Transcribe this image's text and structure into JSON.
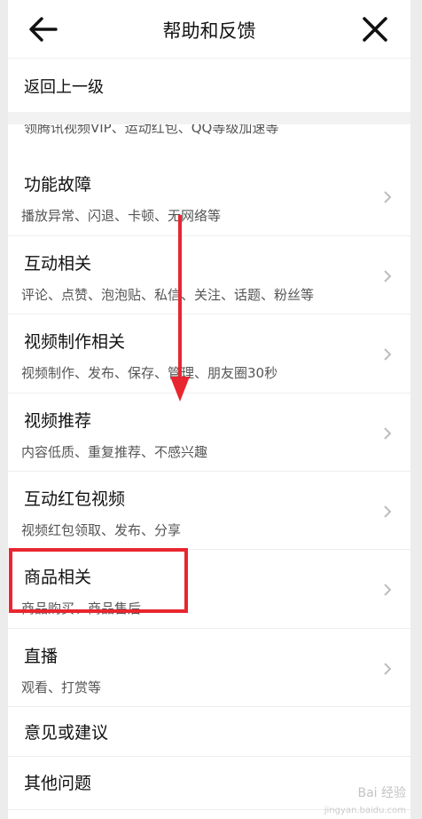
{
  "header": {
    "title": "帮助和反馈",
    "back_icon": "arrow-left-icon",
    "close_icon": "close-icon"
  },
  "back_row": {
    "label": "返回上一级"
  },
  "partial_row": {
    "subtitle": "领腾讯视频VIP、运动红包、QQ等级加速等"
  },
  "items": [
    {
      "label": "功能故障",
      "subtitle": "播放异常、闪退、卡顿、无网络等"
    },
    {
      "label": "互动相关",
      "subtitle": "评论、点赞、泡泡贴、私信、关注、话题、粉丝等"
    },
    {
      "label": "视频制作相关",
      "subtitle": "视频制作、发布、保存、管理、朋友圈30秒"
    },
    {
      "label": "视频推荐",
      "subtitle": "内容低质、重复推荐、不感兴趣"
    },
    {
      "label": "互动红包视频",
      "subtitle": "视频红包领取、发布、分享"
    },
    {
      "label": "商品相关",
      "subtitle": "商品购买、商品售后"
    },
    {
      "label": "直播",
      "subtitle": "观看、打赏等"
    }
  ],
  "plain_items": [
    {
      "label": "意见或建议"
    },
    {
      "label": "其他问题"
    }
  ],
  "annotation": {
    "highlight_color": "#e8262f",
    "arrow_color": "#e8262f"
  },
  "watermark": {
    "text": "Bai 经验",
    "sub": "jingyan.baidu.com"
  }
}
